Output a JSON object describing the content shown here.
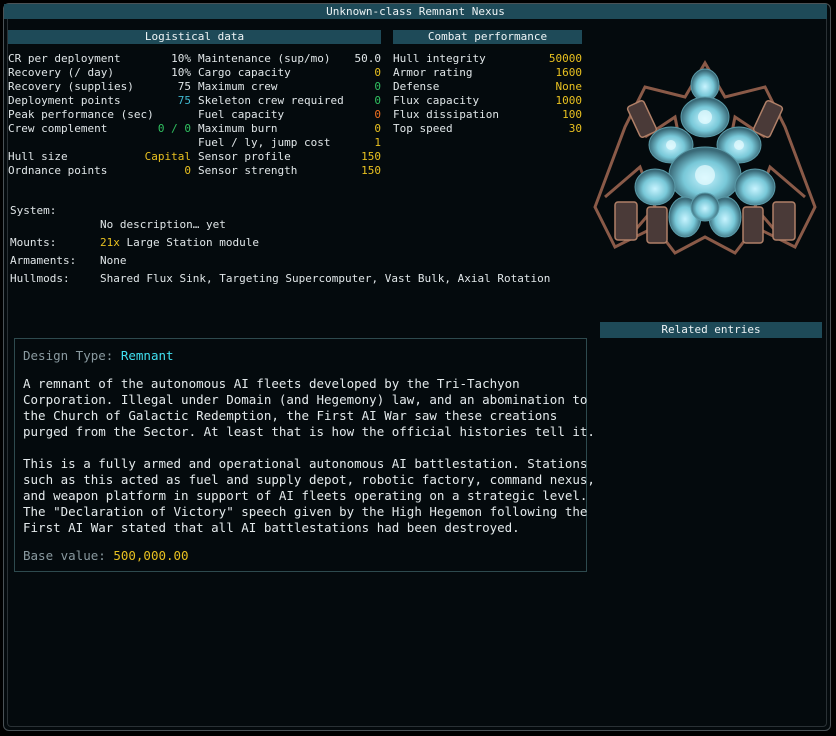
{
  "title": "Unknown-class Remnant Nexus",
  "logistical": {
    "header": "Logistical data",
    "col1": [
      {
        "label": "CR per deployment",
        "value": "10%",
        "color": "white"
      },
      {
        "label": " Recovery (/ day)",
        "value": "10%",
        "color": "white"
      },
      {
        "label": " Recovery (supplies)",
        "value": "75",
        "color": "white"
      },
      {
        "label": " Deployment points",
        "value": "75",
        "color": "cyan"
      },
      {
        "label": "Peak performance (sec)",
        "value": "",
        "color": "white"
      },
      {
        "label": "Crew complement",
        "value": "0 / 0",
        "color": "green"
      },
      {
        "label": "",
        "value": "",
        "color": "white"
      },
      {
        "label": "Hull size",
        "value": "Capital",
        "color": "yellow"
      },
      {
        "label": "Ordnance points",
        "value": "0",
        "color": "yellow"
      }
    ],
    "col2": [
      {
        "label": "Maintenance (sup/mo)",
        "value": "50.0",
        "color": "white"
      },
      {
        "label": "Cargo capacity",
        "value": "0",
        "color": "yellow"
      },
      {
        "label": "Maximum crew",
        "value": "0",
        "color": "green"
      },
      {
        "label": "Skeleton crew required",
        "value": "0",
        "color": "green"
      },
      {
        "label": "Fuel capacity",
        "value": "0",
        "color": "orange"
      },
      {
        "label": "Maximum burn",
        "value": "0",
        "color": "yellow"
      },
      {
        "label": "Fuel / ly, jump cost",
        "value": "1",
        "color": "yellow"
      },
      {
        "label": "Sensor profile",
        "value": "150",
        "color": "yellow"
      },
      {
        "label": "Sensor strength",
        "value": "150",
        "color": "yellow"
      }
    ]
  },
  "combat": {
    "header": "Combat performance",
    "rows": [
      {
        "label": "Hull integrity",
        "value": "50000",
        "color": "yellow"
      },
      {
        "label": "Armor rating",
        "value": "1600",
        "color": "yellow"
      },
      {
        "label": "Defense",
        "value": "None",
        "color": "yellow"
      },
      {
        "label": "Flux capacity",
        "value": "1000",
        "color": "yellow"
      },
      {
        "label": "Flux dissipation",
        "value": "100",
        "color": "yellow"
      },
      {
        "label": "Top speed",
        "value": "30",
        "color": "yellow"
      }
    ]
  },
  "system": {
    "label": "System:",
    "description": "No description… yet",
    "mounts_label": "Mounts:",
    "mounts_count": "21x",
    "mounts_value": "Large Station module",
    "armaments_label": "Armaments:",
    "armaments_value": "None",
    "hullmods_label": "Hullmods:",
    "hullmods_value": "Shared Flux Sink, Targeting Supercomputer, Vast Bulk, Axial Rotation"
  },
  "related": {
    "header": "Related entries"
  },
  "design": {
    "label": "Design Type:",
    "value": "Remnant",
    "para1": [
      "A remnant of the autonomous AI fleets developed by the Tri-Tachyon",
      "Corporation. Illegal under Domain (and Hegemony) law, and an abomination to",
      "the Church of Galactic Redemption, the First AI War saw these creations",
      "purged from the Sector. At least that is how the official histories tell it."
    ],
    "para2": [
      "This is a fully armed and operational autonomous AI battlestation. Stations",
      "such as this acted as fuel and supply depot, robotic factory, command nexus,",
      "and weapon platform in support of AI fleets operating on a strategic level.",
      "The \"Declaration of Victory\" speech given by the High Hegemon following the",
      "First AI War stated that all AI battlestations had been destroyed."
    ],
    "base_label": "Base value:",
    "base_value": "500,000.00"
  }
}
